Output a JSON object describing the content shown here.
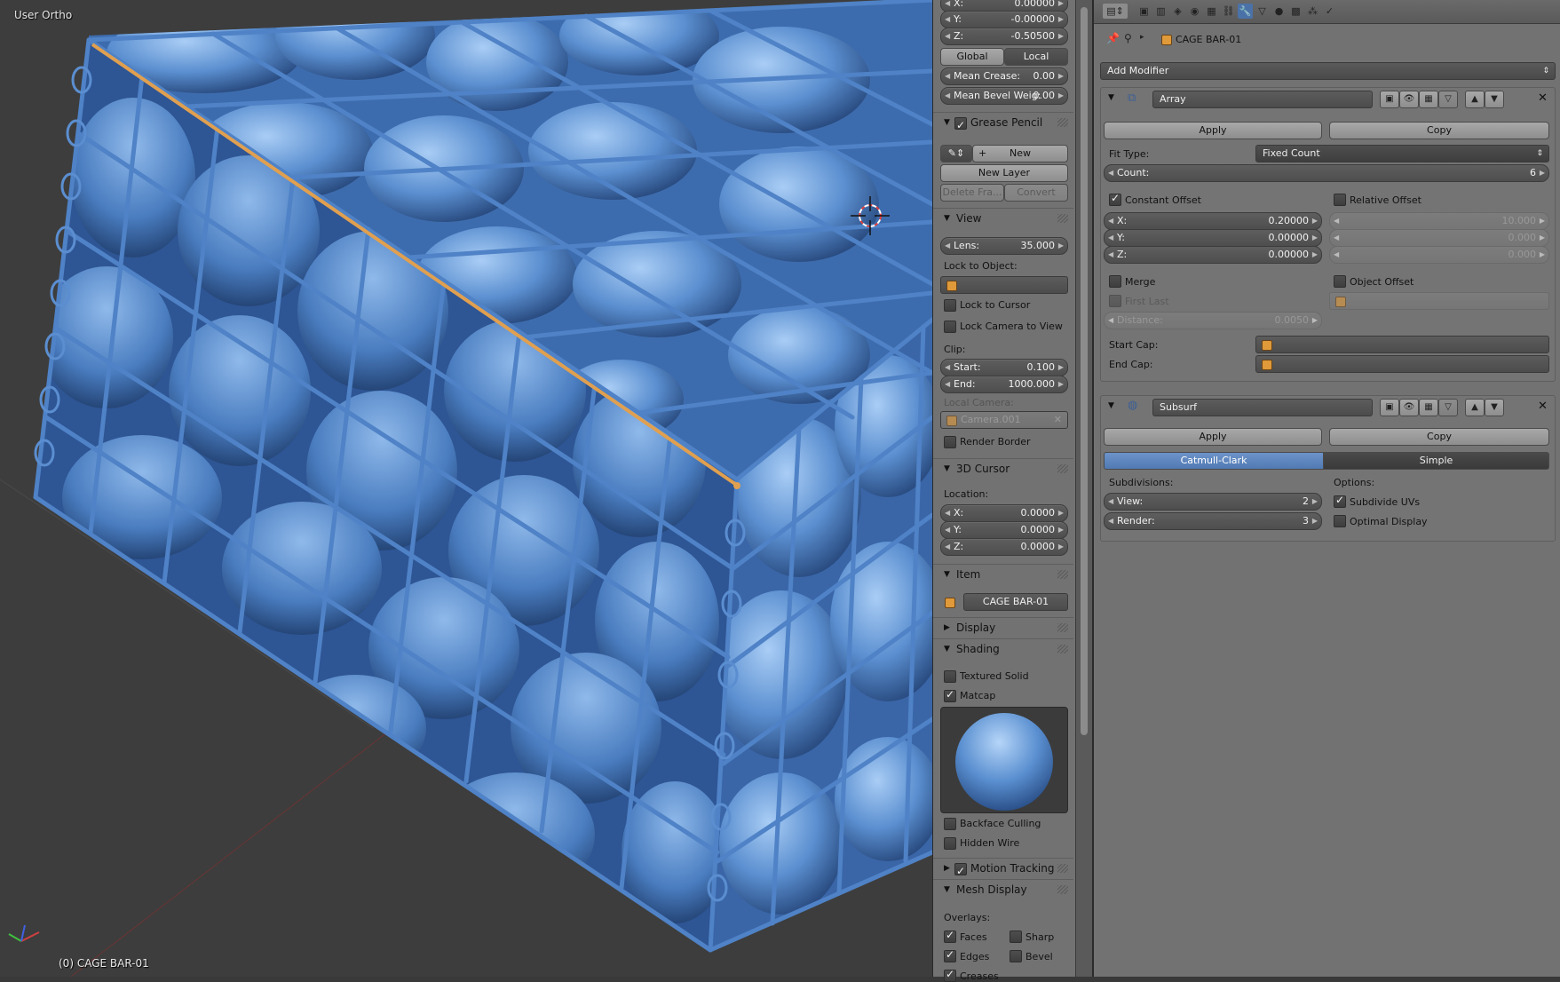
{
  "viewport": {
    "view_name": "User Ortho",
    "status": "(0) CAGE BAR-01"
  },
  "npanel": {
    "transform": {
      "x": {
        "label": "X:",
        "value": "0.00000"
      },
      "y": {
        "label": "Y:",
        "value": "-0.00000"
      },
      "z": {
        "label": "Z:",
        "value": "-0.50500"
      },
      "global_label": "Global",
      "local_label": "Local",
      "mean_crease": {
        "label": "Mean Crease:",
        "value": "0.00"
      },
      "mean_bevel": {
        "label": "Mean Bevel Weig:",
        "value": "0.00"
      }
    },
    "grease_pencil": {
      "title": "Grease Pencil",
      "new_label": "New",
      "new_layer_label": "New Layer",
      "delete_frame_label": "Delete Fra...",
      "convert_label": "Convert"
    },
    "view": {
      "title": "View",
      "lens": {
        "label": "Lens:",
        "value": "35.000"
      },
      "lock_to_object": "Lock to Object:",
      "lock_to_cursor": "Lock to Cursor",
      "lock_camera": "Lock Camera to View",
      "clip": "Clip:",
      "clip_start": {
        "label": "Start:",
        "value": "0.100"
      },
      "clip_end": {
        "label": "End:",
        "value": "1000.000"
      },
      "local_camera": "Local Camera:",
      "camera_name": "Camera.001",
      "render_border": "Render Border"
    },
    "cursor": {
      "title": "3D Cursor",
      "location": "Location:",
      "x": {
        "label": "X:",
        "value": "0.0000"
      },
      "y": {
        "label": "Y:",
        "value": "0.0000"
      },
      "z": {
        "label": "Z:",
        "value": "0.0000"
      }
    },
    "item": {
      "title": "Item",
      "name": "CAGE BAR-01"
    },
    "display": {
      "title": "Display"
    },
    "shading": {
      "title": "Shading",
      "textured_solid": "Textured Solid",
      "matcap": "Matcap",
      "backface_culling": "Backface Culling",
      "hidden_wire": "Hidden Wire"
    },
    "motion_tracking": {
      "title": "Motion Tracking"
    },
    "mesh_display": {
      "title": "Mesh Display",
      "overlays": "Overlays:",
      "faces": "Faces",
      "sharp": "Sharp",
      "edges": "Edges",
      "bevel": "Bevel",
      "creases": "Creases"
    }
  },
  "props": {
    "object_name": "CAGE BAR-01",
    "add_modifier": "Add Modifier",
    "array": {
      "name": "Array",
      "apply": "Apply",
      "copy": "Copy",
      "fit_type_label": "Fit Type:",
      "fit_type_value": "Fixed Count",
      "count": {
        "label": "Count:",
        "value": "6"
      },
      "constant_offset": "Constant Offset",
      "relative_offset": "Relative Offset",
      "cx": {
        "label": "X:",
        "value": "0.20000"
      },
      "cy": {
        "label": "Y:",
        "value": "0.00000"
      },
      "cz": {
        "label": "Z:",
        "value": "0.00000"
      },
      "rx": "10.000",
      "ry": "0.000",
      "rz": "0.000",
      "merge": "Merge",
      "first_last": "First Last",
      "object_offset": "Object Offset",
      "distance": {
        "label": "Distance:",
        "value": "0.0050"
      },
      "start_cap": "Start Cap:",
      "end_cap": "End Cap:"
    },
    "subsurf": {
      "name": "Subsurf",
      "apply": "Apply",
      "copy": "Copy",
      "catmull": "Catmull-Clark",
      "simple": "Simple",
      "subdivisions": "Subdivisions:",
      "view": {
        "label": "View:",
        "value": "2"
      },
      "render": {
        "label": "Render:",
        "value": "3"
      },
      "options": "Options:",
      "subdivide_uvs": "Subdivide UVs",
      "optimal_display": "Optimal Display"
    }
  },
  "colors": {
    "accent": "#5179b3",
    "stone": "#5b8fd0",
    "wire": "#4a7cc0",
    "highlight_edge": "#e0a050"
  }
}
